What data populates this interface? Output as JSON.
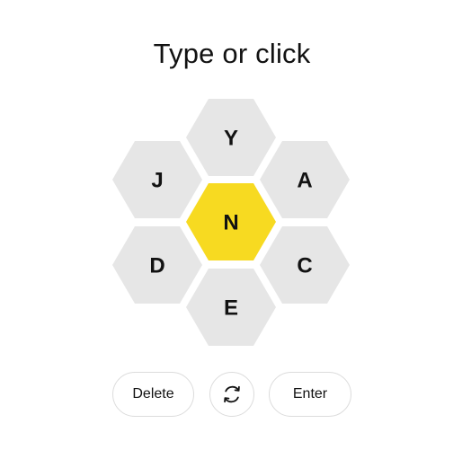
{
  "game": {
    "prompt": "Type or click",
    "center_letter": "N",
    "outer_letters": {
      "top": "Y",
      "upper_left": "J",
      "upper_right": "A",
      "lower_left": "D",
      "lower_right": "C",
      "bottom": "E"
    },
    "colors": {
      "center_fill": "#f7da21",
      "outer_fill": "#e6e6e6",
      "text": "#121212",
      "button_border": "#dcdcdc"
    }
  },
  "controls": {
    "delete_label": "Delete",
    "shuffle_icon": "shuffle-icon",
    "enter_label": "Enter"
  }
}
